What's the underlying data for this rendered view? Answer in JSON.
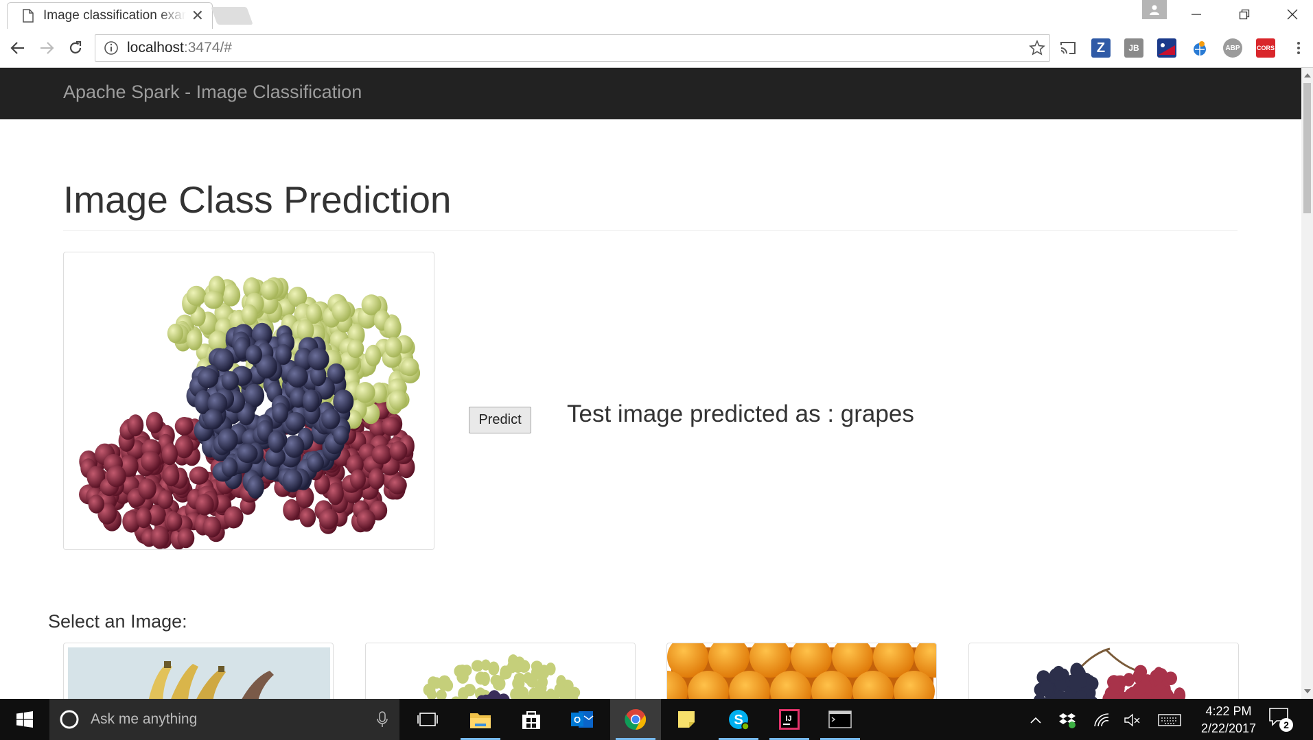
{
  "browser": {
    "tab": {
      "title": "Image classification example",
      "close_glyph": "✕",
      "icon": "document-icon"
    },
    "window_controls": [
      "minimize-icon",
      "restore-icon",
      "close-icon"
    ],
    "address": {
      "host": "localhost",
      "rest": ":3474/#"
    },
    "extensions": [
      {
        "name": "cast-icon"
      },
      {
        "name": "zotero-icon",
        "label": "Z",
        "color": "#2f5aa6"
      },
      {
        "name": "jetbrains-icon",
        "label": "JB",
        "color": "#8a8a8a"
      },
      {
        "name": "flag-extension-icon",
        "color": "#1b3a8a"
      },
      {
        "name": "globe-extension-icon",
        "color": "#2a7bd4"
      },
      {
        "name": "adblock-plus-icon",
        "label": "ABP",
        "color": "#9b9b9b"
      },
      {
        "name": "cors-icon",
        "label": "CORS",
        "color": "#d9262b"
      },
      {
        "name": "menu-icon"
      }
    ]
  },
  "navbar": {
    "brand": "Apache Spark - Image Classification"
  },
  "main": {
    "title": "Image Class Prediction",
    "predict_label": "Predict",
    "prediction_text": "Test image predicted as : grapes",
    "select_label": "Select an Image:"
  },
  "thumbnails": [
    {
      "name": "bananas-thumbnail"
    },
    {
      "name": "grapes-thumbnail"
    },
    {
      "name": "oranges-thumbnail"
    },
    {
      "name": "red-grapes-thumbnail"
    }
  ],
  "taskbar": {
    "search_placeholder": "Ask me anything",
    "apps": [
      "task-view",
      "file-explorer",
      "store",
      "outlook",
      "chrome",
      "sticky-notes",
      "skype",
      "intellij",
      "terminal"
    ],
    "clock": {
      "time": "4:22 PM",
      "date": "2/22/2017"
    },
    "notification_count": "2"
  },
  "colors": {
    "navbar": "#222222",
    "brand_text": "#9d9d9d",
    "taskbar": "#0f0f0f"
  }
}
